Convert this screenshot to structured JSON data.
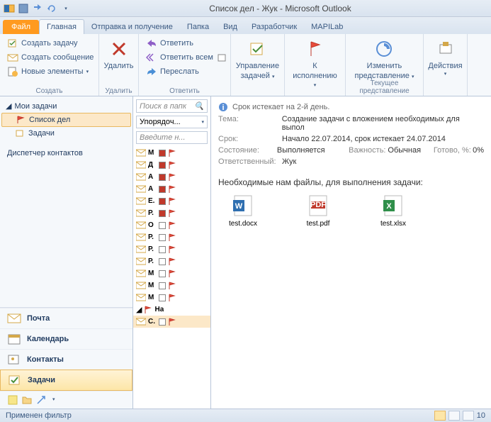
{
  "title": "Список дел - Жук - Microsoft Outlook",
  "tabs": {
    "file": "Файл",
    "items": [
      "Главная",
      "Отправка и получение",
      "Папка",
      "Вид",
      "Разработчик",
      "MAPILab"
    ],
    "active": 0
  },
  "ribbon": {
    "create": {
      "label": "Создать",
      "new_task": "Создать задачу",
      "new_msg": "Создать сообщение",
      "new_items": "Новые элементы"
    },
    "delete": {
      "label": "Удалить",
      "btn": "Удалить"
    },
    "respond": {
      "label": "Ответить",
      "reply": "Ответить",
      "reply_all": "Ответить всем",
      "forward": "Переслать"
    },
    "manage": {
      "label1": "Управление",
      "label2": "задачей"
    },
    "followup": {
      "label1": "К",
      "label2": "исполнению"
    },
    "view": {
      "label": "Текущее представление",
      "btn1": "Изменить",
      "btn2": "представление"
    },
    "actions": {
      "label": "Действия"
    }
  },
  "nav": {
    "header": "Мои задачи",
    "items": [
      {
        "label": "Список дел",
        "sel": true
      },
      {
        "label": "Задачи",
        "sel": false
      }
    ],
    "cm": "Диспетчер контактов",
    "modules": {
      "mail": "Почта",
      "calendar": "Календарь",
      "contacts": "Контакты",
      "tasks": "Задачи"
    }
  },
  "tasklist": {
    "search_ph": "Поиск в папк",
    "sort": "Упорядоч...",
    "type_ph": "Введите н...",
    "rows": [
      {
        "s": "М",
        "cat": "#c0392b"
      },
      {
        "s": "Д",
        "cat": "#c0392b"
      },
      {
        "s": "А",
        "cat": "#c0392b"
      },
      {
        "s": "А",
        "cat": "#c0392b"
      },
      {
        "s": "Е.",
        "cat": "#c0392b"
      },
      {
        "s": "Р.",
        "cat": "#c0392b"
      },
      {
        "s": "О",
        "cat": ""
      },
      {
        "s": "Р.",
        "cat": ""
      },
      {
        "s": "Р.",
        "cat": ""
      },
      {
        "s": "Р.",
        "cat": ""
      },
      {
        "s": "М",
        "cat": ""
      },
      {
        "s": "М",
        "cat": ""
      },
      {
        "s": "М",
        "cat": ""
      },
      {
        "s": "На",
        "cat": "",
        "header": true
      },
      {
        "s": "С.",
        "cat": "",
        "sel": true
      }
    ]
  },
  "reading": {
    "banner": "Срок истекает на 2-й день.",
    "fields": {
      "subject_l": "Тема:",
      "subject_v": "Создание задачи с вложением необходимых для выпол",
      "due_l": "Срок:",
      "due_v": "Начало 22.07.2014, срок истекает 24.07.2014",
      "status_l": "Состояние:",
      "status_v": "Выполняется",
      "priority_l": "Важность:",
      "priority_v": "Обычная",
      "pct_l": "Готово, %:",
      "pct_v": "0%",
      "owner_l": "Ответственный:",
      "owner_v": "Жук"
    },
    "attach_header": "Необходимые нам файлы, для выполнения задачи:",
    "attachments": [
      {
        "name": "test.docx",
        "type": "word"
      },
      {
        "name": "test.pdf",
        "type": "pdf"
      },
      {
        "name": "test.xlsx",
        "type": "excel"
      }
    ]
  },
  "status": {
    "text": "Применен фильтр",
    "zoom": "10"
  }
}
